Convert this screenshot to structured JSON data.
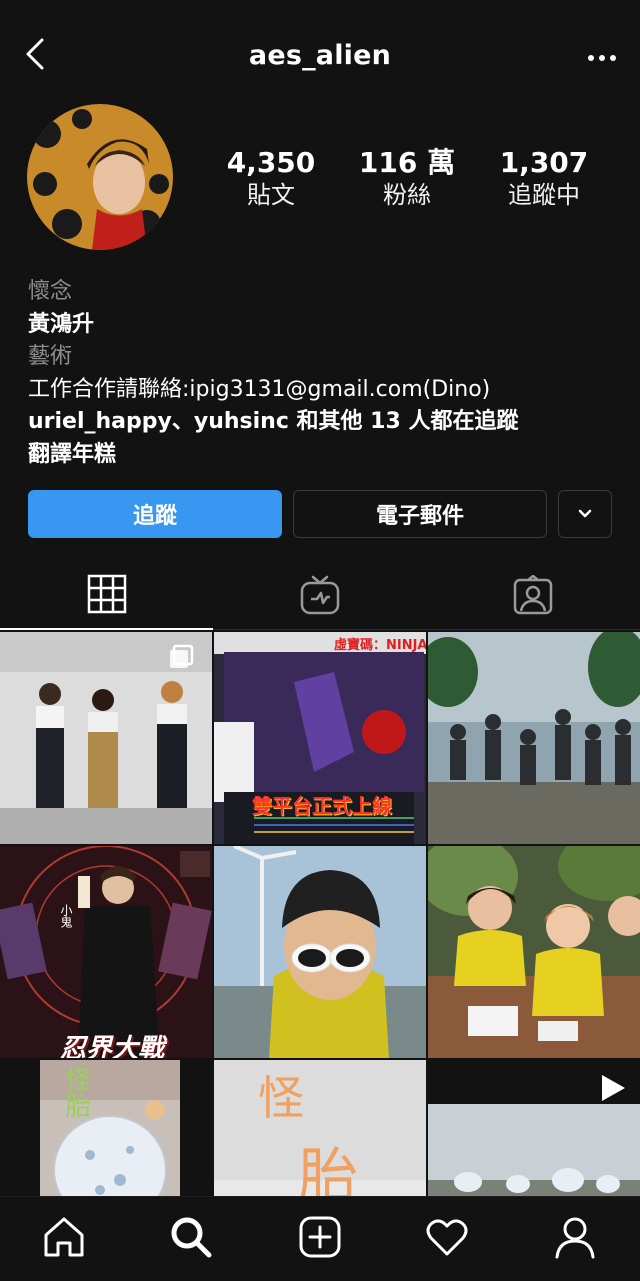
{
  "header": {
    "username": "aes_alien",
    "back_icon": "chevron-left-icon",
    "more_icon": "more-horizontal-icon"
  },
  "stats": [
    {
      "value": "4,350",
      "label": "貼文"
    },
    {
      "value": "116 萬",
      "label": "粉絲"
    },
    {
      "value": "1,307",
      "label": "追蹤中"
    }
  ],
  "bio": {
    "line1": "懷念",
    "name": "黃鴻升",
    "category": "藝術",
    "contact": "工作合作請聯絡:ipig3131@gmail.com(Dino)",
    "followed_by": "uriel_happy、yuhsinc 和其他 13 人都在追蹤",
    "translate": "翻譯年糕"
  },
  "actions": {
    "follow": "追蹤",
    "email": "電子郵件"
  },
  "tabs": [
    "grid-icon",
    "igtv-icon",
    "tagged-icon"
  ],
  "posts": {
    "p2_banner": "虛寶碼：NINJA",
    "p2_caption": "雙平台正式上線",
    "p4_name": "小鬼",
    "p4_title": "忍界大戰",
    "p7_text": "怪胎",
    "p8_char1": "怪",
    "p8_char2": "胎"
  },
  "nav": [
    "home-icon",
    "search-icon",
    "add-post-icon",
    "activity-heart-icon",
    "profile-icon"
  ],
  "colors": {
    "background": "#121212",
    "follow_button": "#3897f0",
    "muted_text": "#8e8e8e"
  }
}
